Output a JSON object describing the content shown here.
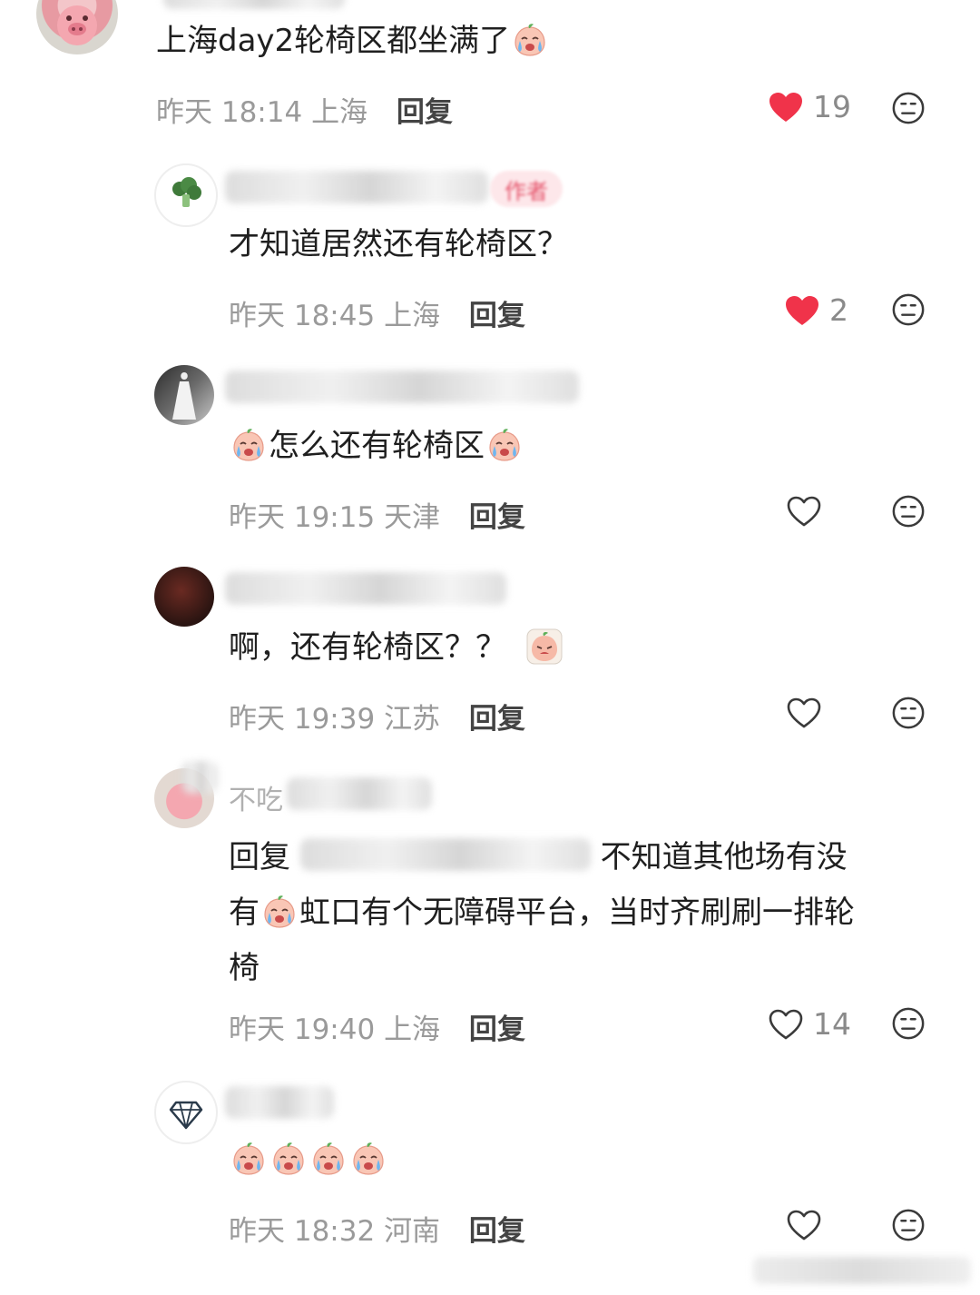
{
  "comments": [
    {
      "avatar": "pink-pig-avatar",
      "text": "上海day2轮椅区都坐满了",
      "emoji_after": [
        "crying-peach-emoji"
      ],
      "date": "昨天",
      "time": "18:14",
      "location": "上海",
      "reply_label": "回复",
      "likes": "19",
      "liked": true
    },
    {
      "avatar": "broccoli-avatar",
      "badge": "作者",
      "text": "才知道居然还有轮椅区？",
      "date": "昨天",
      "time": "18:45",
      "location": "上海",
      "reply_label": "回复",
      "likes": "2",
      "liked": true
    },
    {
      "avatar": "white-dress-avatar",
      "text": "怎么还有轮椅区",
      "emoji_before": [
        "crying-peach-emoji"
      ],
      "emoji_after": [
        "crying-peach-emoji"
      ],
      "date": "昨天",
      "time": "19:15",
      "location": "天津",
      "reply_label": "回复",
      "likes": "",
      "liked": false
    },
    {
      "avatar": "dark-portrait-avatar",
      "text": "啊，还有轮椅区？？",
      "emoji_after": [
        "tearful-peach-emoji"
      ],
      "date": "昨天",
      "time": "19:39",
      "location": "江苏",
      "reply_label": "回复",
      "likes": "",
      "liked": false
    },
    {
      "avatar": "pink-pig-avatar",
      "name_visible": "不吃",
      "reply_prefix": "回复",
      "line1_tail": "不知道其他场有没",
      "line2_a": "有",
      "line2_b": "虹口有个无障碍平台，当时齐刷刷一排轮",
      "line3": "椅",
      "date": "昨天",
      "time": "19:40",
      "location": "上海",
      "reply_label": "回复",
      "likes": "14",
      "liked": false
    },
    {
      "avatar": "diamond-avatar",
      "emoji_count": 4,
      "date": "昨天",
      "time": "18:32",
      "location": "河南",
      "reply_label": "回复",
      "likes": "",
      "liked": false
    }
  ],
  "colors": {
    "heart_red": "#f0334a",
    "meta_gray": "#9a9a9a",
    "text": "#1f1f1f"
  }
}
